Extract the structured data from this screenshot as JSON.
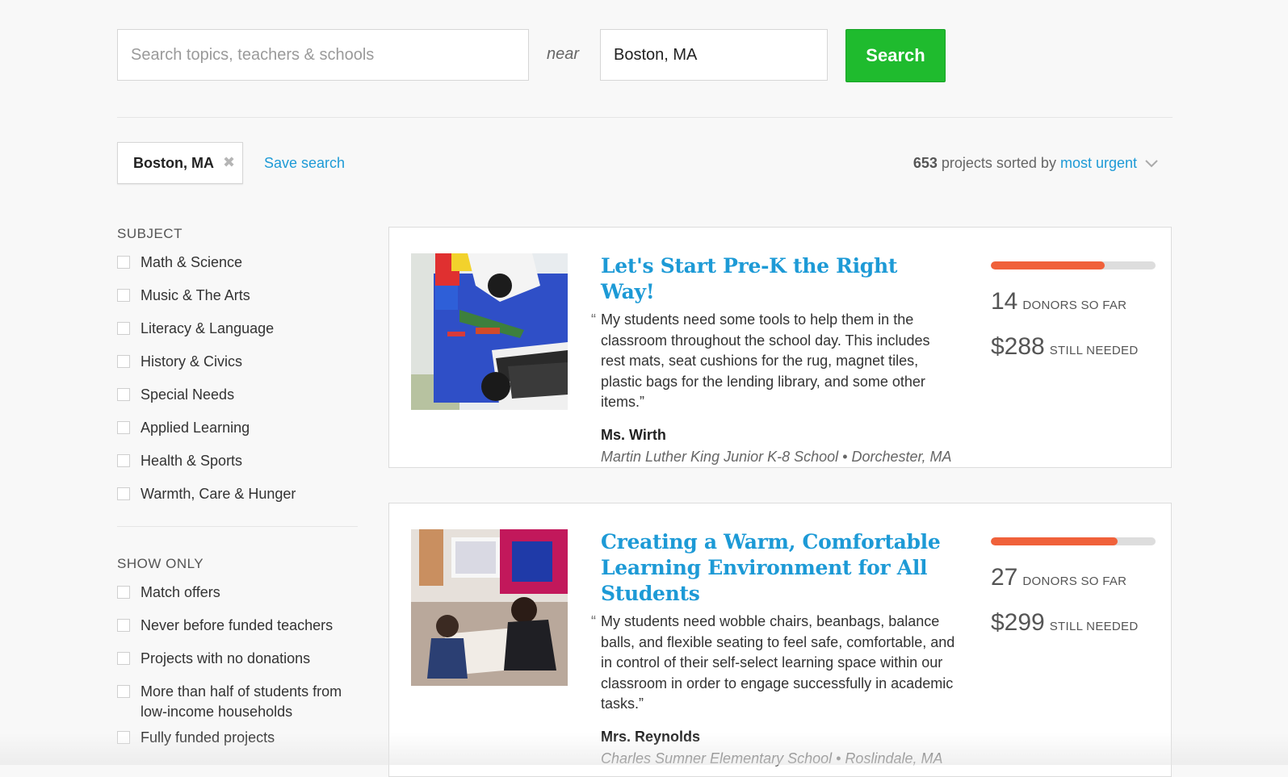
{
  "search": {
    "topic_placeholder": "Search topics, teachers & schools",
    "topic_value": "",
    "near_label": "near",
    "location_value": "Boston, MA",
    "button_label": "Search"
  },
  "filter_bar": {
    "chip_label": "Boston, MA",
    "chip_remove": "✖",
    "save_search": "Save search",
    "count": "653",
    "sorted_text": "projects sorted by",
    "sort_value": "most urgent"
  },
  "sidebar": {
    "subject_title": "SUBJECT",
    "subjects": [
      {
        "label": "Math & Science"
      },
      {
        "label": "Music & The Arts"
      },
      {
        "label": "Literacy & Language"
      },
      {
        "label": "History & Civics"
      },
      {
        "label": "Special Needs"
      },
      {
        "label": "Applied Learning"
      },
      {
        "label": "Health & Sports"
      },
      {
        "label": "Warmth, Care & Hunger"
      }
    ],
    "show_only_title": "SHOW ONLY",
    "show_only": [
      {
        "label": "Match offers"
      },
      {
        "label": "Never before funded teachers"
      },
      {
        "label": "Projects with no donations"
      },
      {
        "label": "More than half of students from low-income households"
      },
      {
        "label": "Fully funded projects"
      }
    ]
  },
  "projects": [
    {
      "title": "Let's Start Pre-K the Right Way!",
      "quote": "My students need some tools to help them in the classroom throughout the school day. This includes rest mats, seat cushions for the rug, magnet tiles, plastic bags for the lending library, and some other items.”",
      "teacher": "Ms. Wirth",
      "school": "Martin Luther King Junior K-8 School • Dorchester, MA",
      "donors": "14",
      "donors_label": "DONORS SO FAR",
      "needed": "$288",
      "needed_label": "STILL NEEDED",
      "progress_percent": 69
    },
    {
      "title": "Creating a Warm, Comfortable Learning Environment for All Students",
      "quote": "My students need wobble chairs, beanbags, balance balls, and flexible seating to feel safe, comfortable, and in control of their self-select learning space within our classroom in order to engage successfully in academic tasks.”",
      "teacher": "Mrs. Reynolds",
      "school": "Charles Sumner Elementary School • Roslindale, MA",
      "donors": "27",
      "donors_label": "DONORS SO FAR",
      "needed": "$299",
      "needed_label": "STILL NEEDED",
      "progress_percent": 77
    }
  ],
  "colors": {
    "accent_link": "#1d9ad6",
    "search_button": "#1fbb2e",
    "progress": "#f0613a"
  }
}
